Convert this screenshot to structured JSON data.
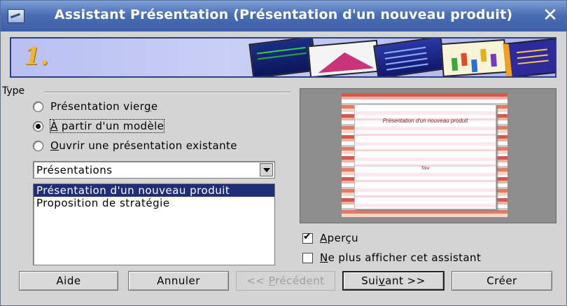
{
  "window": {
    "title": "Assistant Présentation (Présentation d'un nouveau produit)",
    "close_label": "✕"
  },
  "banner": {
    "step_label": "1."
  },
  "type_group": {
    "label": "Type",
    "options": [
      {
        "pre": "Présentation vier",
        "accel": "g",
        "post": "e",
        "checked": false
      },
      {
        "pre": "",
        "accel": "À",
        "post": " partir d'un modèle",
        "checked": true
      },
      {
        "pre": "",
        "accel": "O",
        "post": "uvrir une présentation existante",
        "checked": false
      }
    ]
  },
  "category_select": {
    "value": "Présentations"
  },
  "template_list": {
    "items": [
      {
        "label": "Présentation d'un nouveau produit",
        "selected": true
      },
      {
        "label": "Proposition de stratégie",
        "selected": false
      }
    ]
  },
  "preview": {
    "slide_title": "Présentation d'un nouveau produit",
    "slide_subtitle": "Titre"
  },
  "options": {
    "apercu": {
      "accel": "A",
      "rest": "perçu",
      "checked": true
    },
    "no_show": {
      "accel": "N",
      "rest": "e plus afficher cet assistant",
      "checked": false
    }
  },
  "buttons": {
    "help": "Aide",
    "cancel": "Annuler",
    "previous": {
      "pre": "<< ",
      "accel": "P",
      "post": "récédent"
    },
    "next": {
      "pre": "Sui",
      "accel": "v",
      "post": "ant >>"
    },
    "create": "Créer"
  },
  "colors": {
    "selection": "#1e2f78",
    "title_bar": "#4a6fb4",
    "banner_border": "#2e3f8a"
  }
}
